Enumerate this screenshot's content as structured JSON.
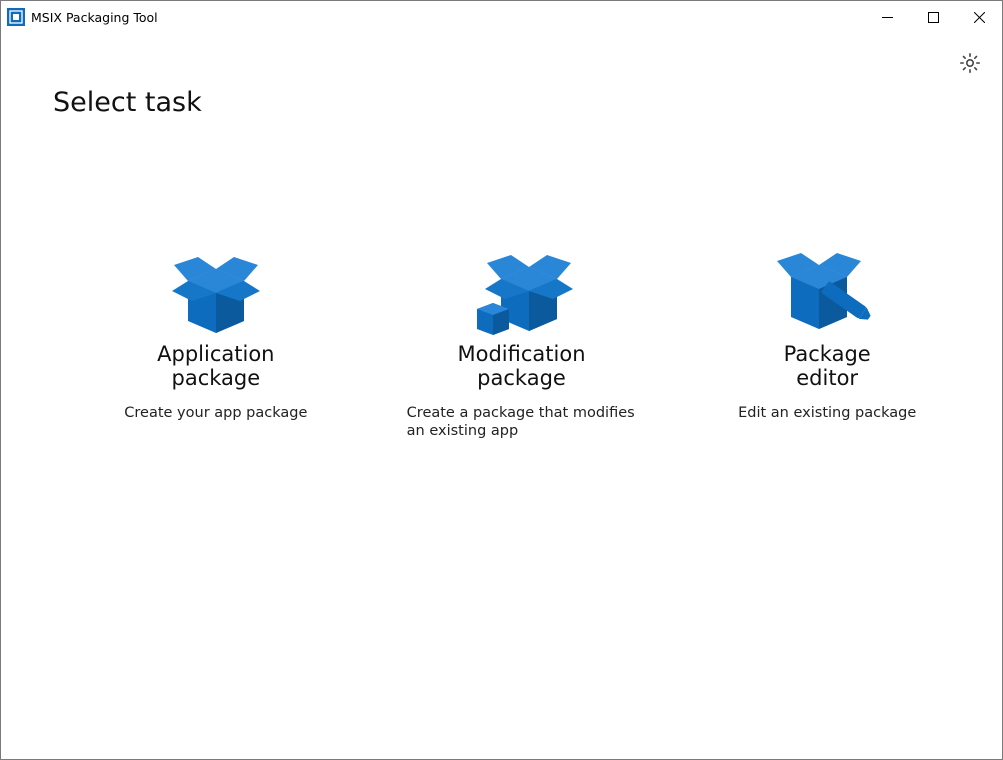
{
  "window": {
    "title": "MSIX Packaging Tool"
  },
  "page": {
    "heading": "Select task"
  },
  "cards": {
    "application": {
      "title": "Application\npackage",
      "sub": "Create your app package"
    },
    "modification": {
      "title": "Modification\npackage",
      "sub": "Create a package that modifies an existing app"
    },
    "editor": {
      "title": "Package\neditor",
      "sub": "Edit an existing package"
    }
  },
  "colors": {
    "accent": "#0e6cbf"
  }
}
